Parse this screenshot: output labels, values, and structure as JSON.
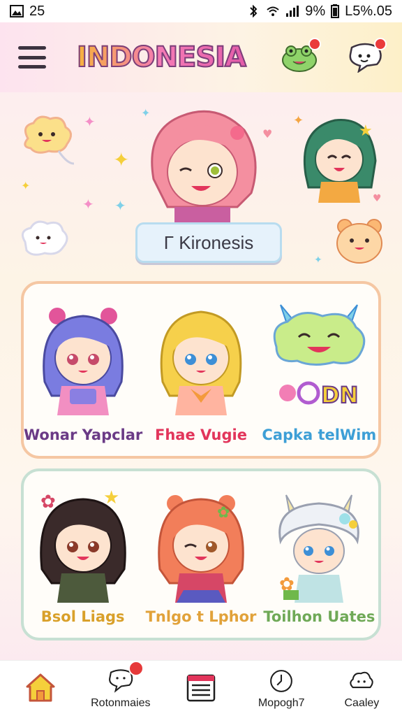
{
  "status_bar": {
    "time": "25",
    "battery_percent": "9%",
    "clock": "L5%.05"
  },
  "header": {
    "app_title": "INDONESIA"
  },
  "hero": {
    "badge_label": "Γ Kironesis"
  },
  "cards": [
    {
      "items": [
        {
          "name": "Wonar Yapclar",
          "color": "#6a3a86",
          "hair": "#7a7ce0",
          "outfit": "#f28fc2"
        },
        {
          "name": "Fhae Vugie",
          "color": "#e2355b",
          "hair": "#f6d04b",
          "outfit": "#ffb4a0"
        },
        {
          "name": "Capka telWim",
          "color": "#3d9fd6",
          "hair": "#9de0a0",
          "outfit": "#f4c74f"
        }
      ]
    },
    {
      "items": [
        {
          "name": "Bsol Liags",
          "color": "#d9a02a",
          "hair": "#3a2a2a",
          "outfit": "#4d5a3c"
        },
        {
          "name": "Tnlgo t Lphor",
          "color": "#e1a23a",
          "hair": "#f27e5a",
          "outfit": "#d64766"
        },
        {
          "name": "Toilhon Uates",
          "color": "#6fa957",
          "hair": "#eef1f6",
          "outfit": "#bfe3e4"
        }
      ]
    }
  ],
  "bottom_nav": [
    {
      "label": "",
      "icon": "home-icon",
      "active": true
    },
    {
      "label": "Rotonmaies",
      "icon": "chat-bubble-icon",
      "badge": true
    },
    {
      "label": "",
      "icon": "calendar-list-icon"
    },
    {
      "label": "Mopogh7",
      "icon": "clock-icon"
    },
    {
      "label": "Caaley",
      "icon": "cloud-icon"
    }
  ]
}
